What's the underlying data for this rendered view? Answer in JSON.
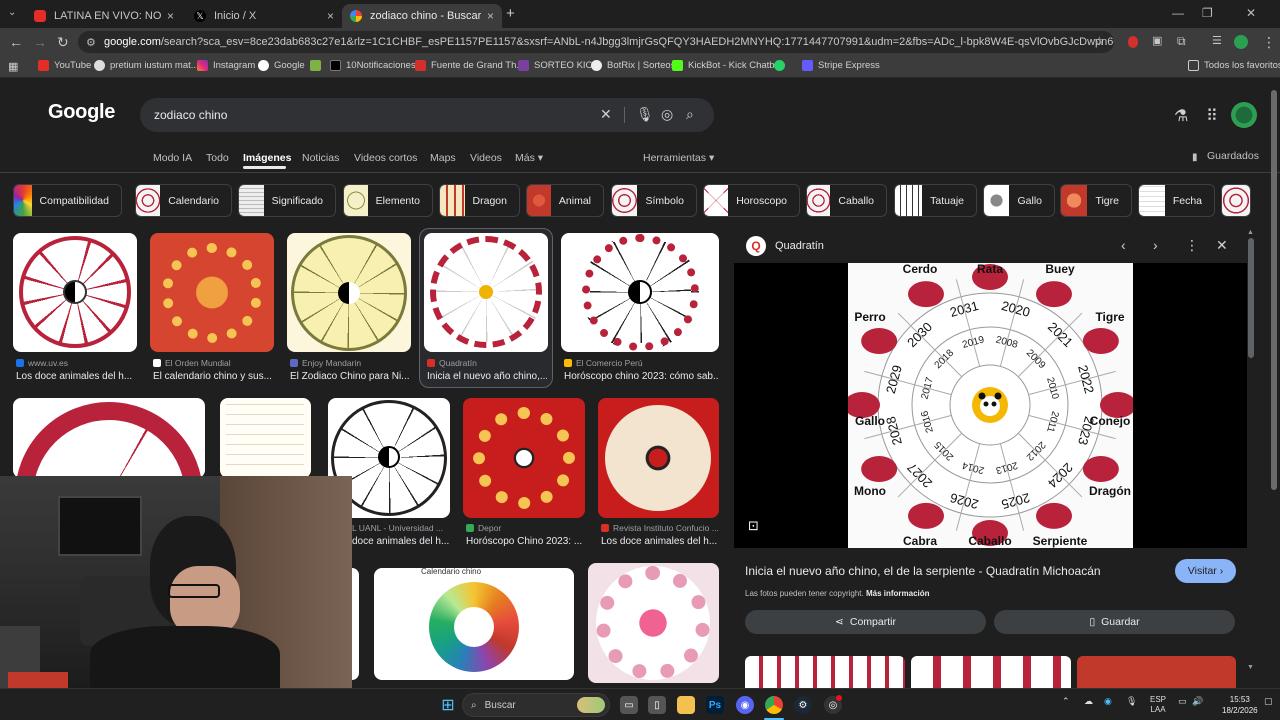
{
  "browser": {
    "tabs": [
      {
        "title": "LATINA EN VIVO: NOTICIAS DE",
        "color": "#e52d27"
      },
      {
        "title": "Inicio / X",
        "color": "#ffffff"
      },
      {
        "title": "zodiaco chino - Buscar con Go",
        "color": "#4285f4"
      }
    ],
    "url_host": "google.com",
    "url_rest": "/search?sca_esv=8ce23dab683c27e1&rlz=1C1CHBF_esPE1157PE1157&sxsrf=ANbL-n4Jbgg3lmjrGsQFQY3HAEDH2MNYHQ:1771447707991&udm=2&fbs=ADc_l-bpk8W4E-qsVlOvbGJcDwpn60DczFdcvPnuv8WQohHLTbSVIdBrj...",
    "bookmarks": [
      "YouTube",
      "pretium iustum mat...",
      "Instagram",
      "Google",
      "",
      "10Notificaciones",
      "Fuente de Grand Th...",
      "SORTEO KICK",
      "BotRix | Sorteos",
      "KickBot - Kick Chatb...",
      "",
      "Stripe Express"
    ],
    "bookmarks_all": "Todos los favoritos"
  },
  "google": {
    "logo": "Google",
    "query": "zodiaco chino",
    "tabs": [
      "Modo IA",
      "Todo",
      "Imágenes",
      "Noticias",
      "Videos cortos",
      "Maps",
      "Videos",
      "Más ▾"
    ],
    "tools": "Herramientas ▾",
    "saved": "Guardados"
  },
  "chips": [
    "Compatibilidad",
    "Calendario",
    "Significado",
    "Elemento",
    "Dragon",
    "Animal",
    "Símbolo",
    "Horoscopo",
    "Caballo",
    "Tatuaje",
    "Gallo",
    "Tigre",
    "Fecha"
  ],
  "results": [
    {
      "source": "www.uv.es",
      "title": "Los doce animales del h..."
    },
    {
      "source": "El Orden Mundial",
      "title": "El calendario chino y sus..."
    },
    {
      "source": "Enjoy Mandarin",
      "title": "El Zodiaco Chino para Ni..."
    },
    {
      "source": "Quadratín",
      "title": "Inicia el nuevo año chino,..."
    },
    {
      "source": "El Comercio Perú",
      "title": "Horóscopo chino 2023: cómo sab..."
    },
    {
      "source": "L UANL - Universidad ...",
      "title": "doce animales del h..."
    },
    {
      "source": "Depor",
      "title": "Horóscopo Chino 2023: ..."
    },
    {
      "source": "Revista Instituto Confucio ...",
      "title": "Los doce animales del h..."
    },
    {
      "source": "",
      "title": "Calendario chino"
    }
  ],
  "panel": {
    "source": "Quadratín",
    "logo_letter": "Q",
    "title": "Inicia el nuevo año chino, el de la serpiente - Quadratín Michoacán",
    "visit": "Visitar ›",
    "copyright": "Las fotos pueden tener copyright.",
    "more_info": "Más información",
    "share": "Compartir",
    "save": "Guardar",
    "animals": [
      "Cerdo",
      "Rata",
      "Buey",
      "Tigre",
      "Conejo",
      "Dragón",
      "Serpiente",
      "Caballo",
      "Cabra",
      "Mono",
      "Gallo",
      "Perro"
    ],
    "years_outer": [
      "2031",
      "2020",
      "2021",
      "2022",
      "2023",
      "2024",
      "2025",
      "2026",
      "2027",
      "2028",
      "2029",
      "2030"
    ],
    "years_inner": [
      "2019",
      "2008",
      "2009",
      "2010",
      "2011",
      "2012",
      "2013",
      "2014",
      "2015",
      "2016",
      "2017",
      "2018"
    ]
  },
  "taskbar": {
    "search": "Buscar",
    "lang_1": "ESP",
    "lang_2": "LAA",
    "time": "15:53",
    "date": "18/2/2026"
  },
  "colors": {
    "zodiac_red": "#b8233b",
    "accent_blue": "#8ab4f8"
  }
}
